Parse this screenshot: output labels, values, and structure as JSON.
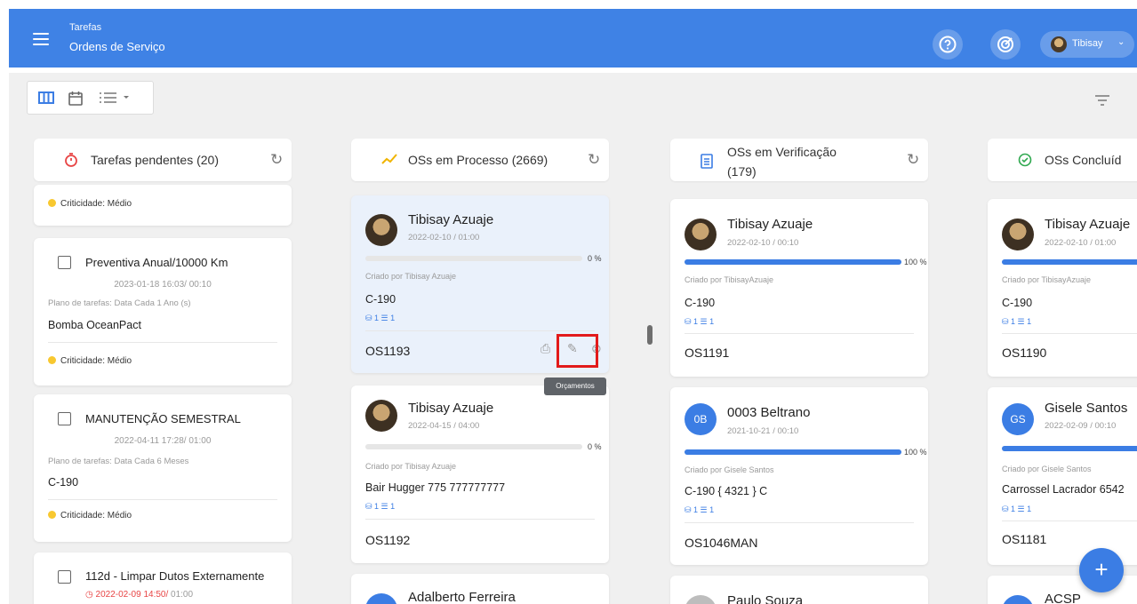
{
  "header": {
    "app_section": "Tarefas",
    "page_title": "Ordens de Serviço",
    "user_name": "Tibisay",
    "brand_color": "#3f82e5"
  },
  "toolbar": {
    "views": [
      "columns-view-icon",
      "calendar-view-icon",
      "list-view-icon"
    ],
    "filter_icon": "filter-icon"
  },
  "columns": [
    {
      "title": "Tarefas pendentes (20)",
      "icon": "timer-icon"
    },
    {
      "title": "OSs em Processo (2669)",
      "icon": "trend-icon"
    },
    {
      "title_line1": "OSs em Verificação",
      "title_line2": "(179)",
      "icon": "clipboard-icon"
    },
    {
      "title": "OSs Concluíd",
      "icon": "check-circle-icon"
    }
  ],
  "pending": {
    "partial_criticality": "Criticidade: Médio",
    "tasks": [
      {
        "title": "Preventiva Anual/10000 Km",
        "date": "2023-01-18 16:03/ 00:10",
        "plan": "Plano de tarefas: Data Cada 1 Ano (s)",
        "equipment": "Bomba OceanPact",
        "criticality": "Criticidade: Médio"
      },
      {
        "title": "MANUTENÇÃO SEMESTRAL",
        "date": "2022-04-11 17:28/ 01:00",
        "plan": "Plano de tarefas: Data Cada 6 Meses",
        "equipment": "C-190",
        "criticality": "Criticidade: Médio"
      },
      {
        "title": "112d - Limpar Dutos Externamente",
        "date": "2022-02-09 14:50/",
        "date_suffix": " 01:00"
      }
    ]
  },
  "in_process": [
    {
      "name": "Tibisay Azuaje",
      "date": "2022-02-10 / 01:00",
      "progress": 0,
      "pct": "0 %",
      "created_by": "Criado por Tibisay Azuaje",
      "equipment": "C-190",
      "counts": "1 ☰ 1",
      "os": "OS1193"
    },
    {
      "name": "Tibisay Azuaje",
      "date": "2022-04-15 / 04:00",
      "progress": 0,
      "pct": "0 %",
      "created_by": "Criado por Tibisay Azuaje",
      "equipment": "Bair Hugger 775 777777777",
      "counts": "1 ☰ 1",
      "os": "OS1192"
    },
    {
      "name": "Adalberto Ferreira",
      "initials": "AF"
    }
  ],
  "verification": [
    {
      "name": "Tibisay Azuaje",
      "date": "2022-02-10 / 00:10",
      "progress": 100,
      "pct": "100 %",
      "created_by": "Criado por TibisayAzuaje",
      "equipment": "C-190",
      "counts": "1 ☰ 1",
      "os": "OS1191"
    },
    {
      "name": "0003 Beltrano",
      "initials": "0B",
      "date": "2021-10-21 / 00:10",
      "progress": 100,
      "pct": "100 %",
      "created_by": "Criado por Gisele Santos",
      "equipment": "C-190 { 4321 } C",
      "counts": "1 ☰ 1",
      "os": "OS1046MAN"
    },
    {
      "name": "Paulo Souza"
    }
  ],
  "completed": [
    {
      "name": "Tibisay Azuaje",
      "date": "2022-02-10 / 01:00",
      "progress": 100,
      "created_by": "Criado por TibisayAzuaje",
      "equipment": "C-190",
      "counts": "1 ☰ 1",
      "os": "OS1190"
    },
    {
      "name": "Gisele Santos",
      "initials": "GS",
      "date": "2022-02-09 / 00:10",
      "progress": 100,
      "created_by": "Criado por Gisele Santos",
      "equipment": "Carrossel Lacrador 6542",
      "counts": "1 ☰ 1",
      "os": "OS1181"
    },
    {
      "name": "ACSP",
      "initials": "AC"
    }
  ],
  "tooltip": "Orçamentos",
  "fab_label": "+"
}
